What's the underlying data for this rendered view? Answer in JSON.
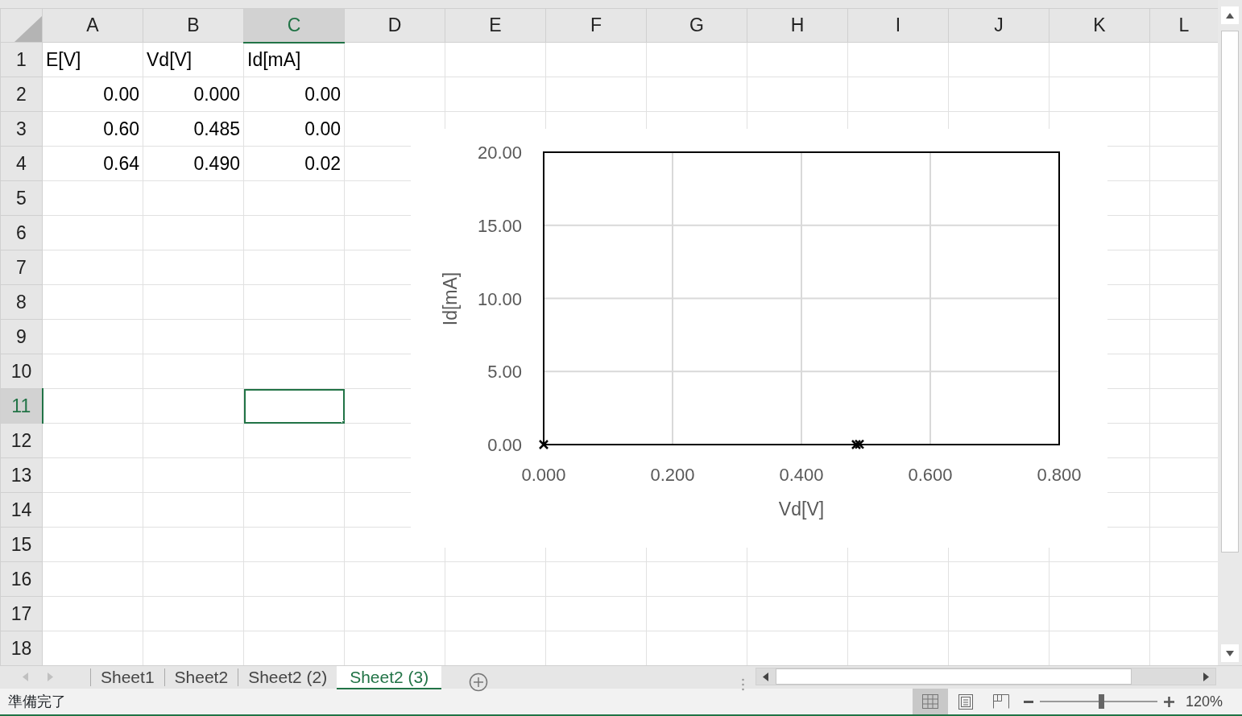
{
  "columns": [
    {
      "label": "A",
      "selected": false
    },
    {
      "label": "B",
      "selected": false
    },
    {
      "label": "C",
      "selected": true
    },
    {
      "label": "D",
      "selected": false
    },
    {
      "label": "E",
      "selected": false
    },
    {
      "label": "F",
      "selected": false
    },
    {
      "label": "G",
      "selected": false
    },
    {
      "label": "H",
      "selected": false
    },
    {
      "label": "I",
      "selected": false
    },
    {
      "label": "J",
      "selected": false
    },
    {
      "label": "K",
      "selected": false
    },
    {
      "label": "L",
      "selected": false
    }
  ],
  "rows": [
    {
      "label": "1",
      "selected": false,
      "kind": "text",
      "cells": [
        "E[V]",
        "Vd[V]",
        "Id[mA]"
      ]
    },
    {
      "label": "2",
      "selected": false,
      "kind": "number",
      "cells": [
        "0.00",
        "0.000",
        "0.00"
      ]
    },
    {
      "label": "3",
      "selected": false,
      "kind": "number",
      "cells": [
        "0.60",
        "0.485",
        "0.00"
      ]
    },
    {
      "label": "4",
      "selected": false,
      "kind": "number",
      "cells": [
        "0.64",
        "0.490",
        "0.02"
      ]
    },
    {
      "label": "5",
      "selected": false
    },
    {
      "label": "6",
      "selected": false
    },
    {
      "label": "7",
      "selected": false
    },
    {
      "label": "8",
      "selected": false
    },
    {
      "label": "9",
      "selected": false
    },
    {
      "label": "10",
      "selected": false
    },
    {
      "label": "11",
      "selected": true
    },
    {
      "label": "12",
      "selected": false
    },
    {
      "label": "13",
      "selected": false
    },
    {
      "label": "14",
      "selected": false
    },
    {
      "label": "15",
      "selected": false
    },
    {
      "label": "16",
      "selected": false
    },
    {
      "label": "17",
      "selected": false
    },
    {
      "label": "18",
      "selected": false
    }
  ],
  "chart": {
    "chart_data": {
      "type": "scatter",
      "xlabel": "Vd[V]",
      "ylabel": "Id[mA]",
      "x": [
        0,
        0.485,
        0.49
      ],
      "series": [
        {
          "color": "#000000",
          "values": [
            0,
            0,
            0.02
          ]
        }
      ],
      "xlim": [
        0,
        0.8
      ],
      "ylim": [
        0,
        20
      ],
      "xticks": [
        {
          "value": 0,
          "label": "0.000"
        },
        {
          "value": 0.2,
          "label": "0.200"
        },
        {
          "value": 0.4,
          "label": "0.400"
        },
        {
          "value": 0.6,
          "label": "0.600"
        },
        {
          "value": 0.8,
          "label": "0.800"
        }
      ],
      "yticks": [
        {
          "value": 0,
          "label": "0.00"
        },
        {
          "value": 5,
          "label": "5.00"
        },
        {
          "value": 10,
          "label": "10.00"
        },
        {
          "value": 15,
          "label": "15.00"
        },
        {
          "value": 20,
          "label": "20.00"
        }
      ],
      "grid": true
    }
  },
  "sheet_tabs": [
    {
      "label": "Sheet1",
      "selected": false
    },
    {
      "label": "Sheet2",
      "selected": false
    },
    {
      "label": "Sheet2 (2)",
      "selected": false
    },
    {
      "label": "Sheet2 (3)",
      "selected": true
    }
  ],
  "status_bar": {
    "text": "準備完了",
    "view_buttons": [
      {
        "kind": "normal",
        "selected": true
      },
      {
        "kind": "page-layout",
        "selected": false
      },
      {
        "kind": "page-break",
        "selected": false
      }
    ],
    "zoom": {
      "level": 0.52,
      "label": "120%"
    }
  }
}
